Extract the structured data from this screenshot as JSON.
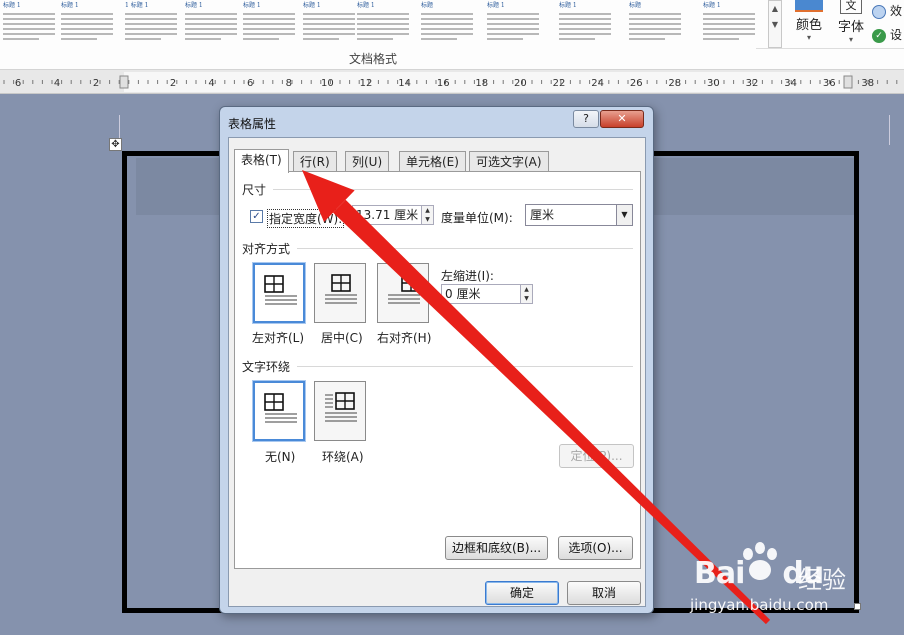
{
  "ribbon": {
    "style_gallery": [
      {
        "title": "标题 1"
      },
      {
        "title": "标题 1"
      },
      {
        "title": "1 标题 1"
      },
      {
        "title": "标题 1"
      },
      {
        "title": "标题 1"
      },
      {
        "title": "标题 1"
      },
      {
        "title": "标题 1"
      },
      {
        "title": "标题"
      },
      {
        "title": "标题 1"
      },
      {
        "title": "标题 1"
      },
      {
        "title": "标题"
      },
      {
        "title": "标题 1"
      }
    ],
    "group_label": "文档格式",
    "colors_label": "颜色",
    "fonts_label": "字体",
    "fonts_glyph": "文",
    "effects_label": "效",
    "set_default_label": "设"
  },
  "ruler": {
    "left_ticks": [
      "6",
      "4",
      "2"
    ],
    "right_ticks": [
      "2",
      "4",
      "6",
      "8",
      "10",
      "12",
      "14",
      "16",
      "18",
      "20",
      "22",
      "24",
      "26",
      "28",
      "30",
      "32",
      "34",
      "36",
      "38"
    ]
  },
  "dialog": {
    "title": "表格属性",
    "help_label": "?",
    "close_label": "✕",
    "tabs": [
      {
        "label": "表格(T)",
        "active": true
      },
      {
        "label": "行(R)",
        "active": false
      },
      {
        "label": "列(U)",
        "active": false
      },
      {
        "label": "单元格(E)",
        "active": false
      },
      {
        "label": "可选文字(A)",
        "active": false
      }
    ],
    "size_section": "尺寸",
    "preferred_width_label": "指定宽度(W):",
    "preferred_width_checked": true,
    "preferred_width_value": "13.71 厘米",
    "measure_in_label": "度量单位(M):",
    "measure_in_value": "厘米",
    "alignment_section": "对齐方式",
    "alignment_options": [
      {
        "label": "左对齐(L)",
        "selected": true
      },
      {
        "label": "居中(C)",
        "selected": false
      },
      {
        "label": "右对齐(H)",
        "selected": false
      }
    ],
    "indent_label": "左缩进(I):",
    "indent_value": "0 厘米",
    "wrapping_section": "文字环绕",
    "wrapping_options": [
      {
        "label": "无(N)",
        "selected": true
      },
      {
        "label": "环绕(A)",
        "selected": false
      }
    ],
    "positioning_button": "定位(P)...",
    "borders_button": "边框和底纹(B)...",
    "options_button": "选项(O)...",
    "ok_button": "确定",
    "cancel_button": "取消"
  },
  "annotation": {
    "color": "#e8201a"
  },
  "watermark": {
    "logo": "Bai",
    "logo_tail": "du",
    "cn_text": "经验",
    "url": "jingyan.baidu.com"
  },
  "colors": {
    "ribbon_bg": "#fdfdfd",
    "workspace_bg": "#8592ad",
    "dialog_frame": "#c4d4ea",
    "selection_blue": "#4a8ad8",
    "close_red": "#c8402a"
  }
}
